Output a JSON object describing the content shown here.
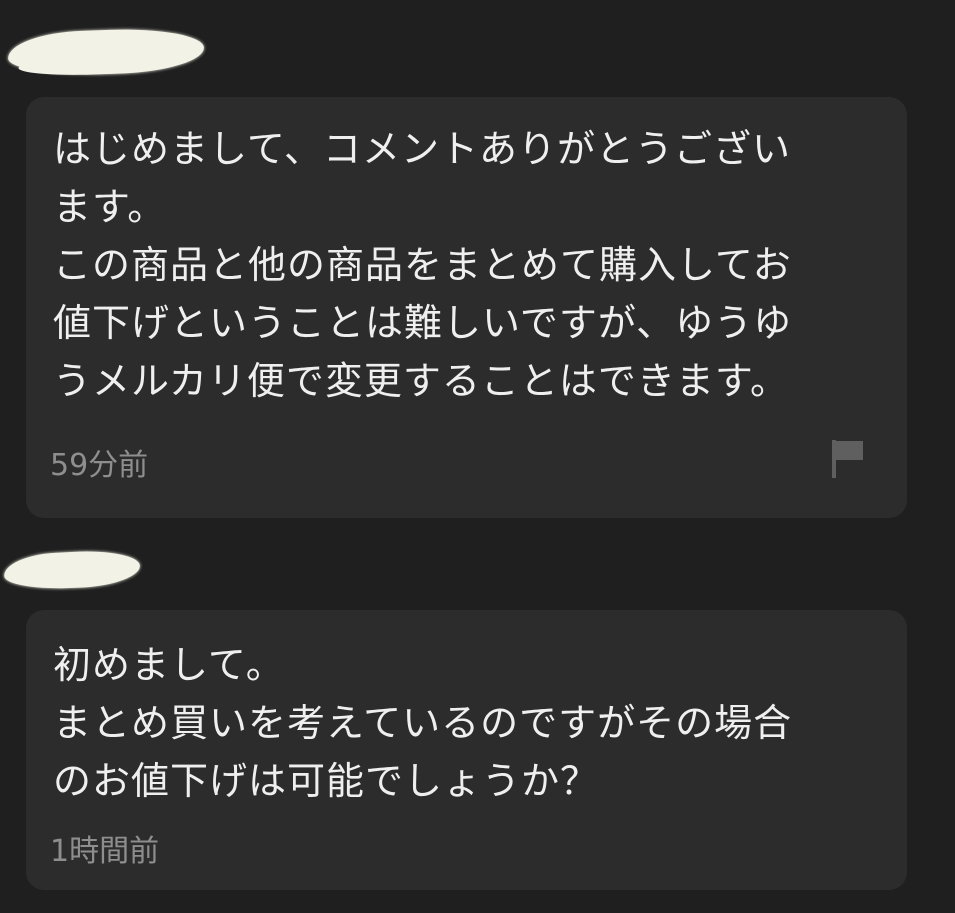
{
  "comments": [
    {
      "text": "はじめまして、コメントありがとうござい\nます。\nこの商品と他の商品をまとめて購入してお\n値下げということは難しいですが、ゆうゆ\nうメルカリ便で変更することはできます。",
      "time": "59分前",
      "icons": [
        "flag-icon"
      ]
    },
    {
      "text": "初めまして。\nまとめ買いを考えているのですがその場合\nのお値下げは可能でしょうか？",
      "time": "1時間前"
    }
  ]
}
